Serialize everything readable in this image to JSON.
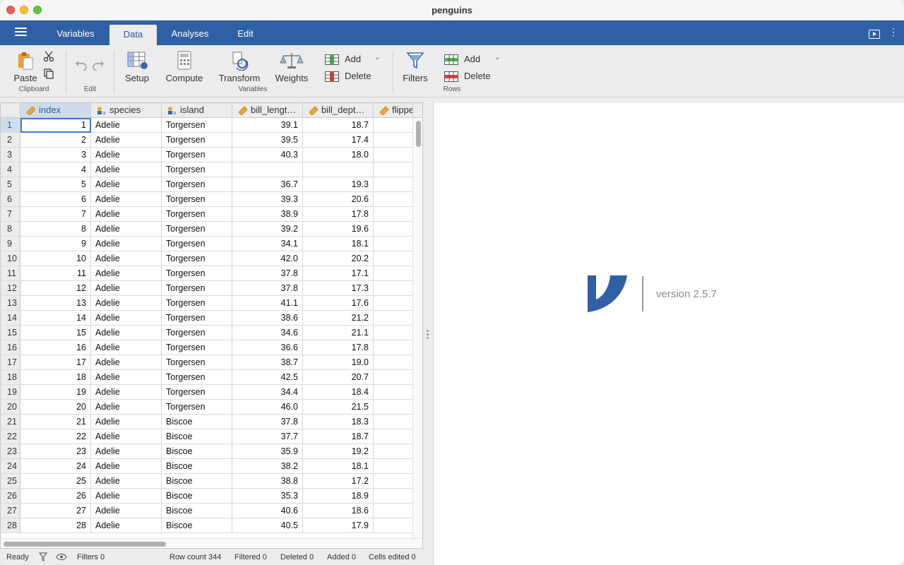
{
  "window": {
    "title": "penguins"
  },
  "menu": {
    "tabs": [
      {
        "label": "Variables"
      },
      {
        "label": "Data"
      },
      {
        "label": "Analyses"
      },
      {
        "label": "Edit"
      }
    ],
    "active_tab": "Data"
  },
  "ribbon": {
    "clipboard": {
      "paste": "Paste",
      "group": "Clipboard"
    },
    "edit": {
      "group": "Edit"
    },
    "variables": {
      "setup": "Setup",
      "compute": "Compute",
      "transform": "Transform",
      "weights": "Weights",
      "add": "Add",
      "delete": "Delete",
      "group": "Variables"
    },
    "rows": {
      "filters": "Filters",
      "add": "Add",
      "delete": "Delete",
      "group": "Rows"
    }
  },
  "colors": {
    "accent": "#3060a4",
    "selection": "#cfdcef",
    "focus": "#3e7bd3"
  },
  "grid": {
    "columns": [
      {
        "name": "index",
        "type": "continuous-icon"
      },
      {
        "name": "species",
        "type": "nominal-text-icon"
      },
      {
        "name": "island",
        "type": "nominal-text-icon"
      },
      {
        "name": "bill_lengt…",
        "type": "continuous-icon"
      },
      {
        "name": "bill_dept…",
        "type": "continuous-icon"
      },
      {
        "name": "flipper_",
        "type": "continuous-icon"
      }
    ],
    "rows": [
      [
        "1",
        "Adelie",
        "Torgersen",
        "39.1",
        "18.7"
      ],
      [
        "2",
        "Adelie",
        "Torgersen",
        "39.5",
        "17.4"
      ],
      [
        "3",
        "Adelie",
        "Torgersen",
        "40.3",
        "18.0"
      ],
      [
        "4",
        "Adelie",
        "Torgersen",
        "",
        ""
      ],
      [
        "5",
        "Adelie",
        "Torgersen",
        "36.7",
        "19.3"
      ],
      [
        "6",
        "Adelie",
        "Torgersen",
        "39.3",
        "20.6"
      ],
      [
        "7",
        "Adelie",
        "Torgersen",
        "38.9",
        "17.8"
      ],
      [
        "8",
        "Adelie",
        "Torgersen",
        "39.2",
        "19.6"
      ],
      [
        "9",
        "Adelie",
        "Torgersen",
        "34.1",
        "18.1"
      ],
      [
        "10",
        "Adelie",
        "Torgersen",
        "42.0",
        "20.2"
      ],
      [
        "11",
        "Adelie",
        "Torgersen",
        "37.8",
        "17.1"
      ],
      [
        "12",
        "Adelie",
        "Torgersen",
        "37.8",
        "17.3"
      ],
      [
        "13",
        "Adelie",
        "Torgersen",
        "41.1",
        "17.6"
      ],
      [
        "14",
        "Adelie",
        "Torgersen",
        "38.6",
        "21.2"
      ],
      [
        "15",
        "Adelie",
        "Torgersen",
        "34.6",
        "21.1"
      ],
      [
        "16",
        "Adelie",
        "Torgersen",
        "36.6",
        "17.8"
      ],
      [
        "17",
        "Adelie",
        "Torgersen",
        "38.7",
        "19.0"
      ],
      [
        "18",
        "Adelie",
        "Torgersen",
        "42.5",
        "20.7"
      ],
      [
        "19",
        "Adelie",
        "Torgersen",
        "34.4",
        "18.4"
      ],
      [
        "20",
        "Adelie",
        "Torgersen",
        "46.0",
        "21.5"
      ],
      [
        "21",
        "Adelie",
        "Biscoe",
        "37.8",
        "18.3"
      ],
      [
        "22",
        "Adelie",
        "Biscoe",
        "37.7",
        "18.7"
      ],
      [
        "23",
        "Adelie",
        "Biscoe",
        "35.9",
        "19.2"
      ],
      [
        "24",
        "Adelie",
        "Biscoe",
        "38.2",
        "18.1"
      ],
      [
        "25",
        "Adelie",
        "Biscoe",
        "38.8",
        "17.2"
      ],
      [
        "26",
        "Adelie",
        "Biscoe",
        "35.3",
        "18.9"
      ],
      [
        "27",
        "Adelie",
        "Biscoe",
        "40.6",
        "18.6"
      ],
      [
        "28",
        "Adelie",
        "Biscoe",
        "40.5",
        "17.9"
      ]
    ]
  },
  "results": {
    "version": "version 2.5.7"
  },
  "status": {
    "ready": "Ready",
    "filters": "Filters 0",
    "row_count": "Row count 344",
    "filtered": "Filtered 0",
    "deleted": "Deleted 0",
    "added": "Added 0",
    "cells_edited": "Cells edited 0"
  }
}
